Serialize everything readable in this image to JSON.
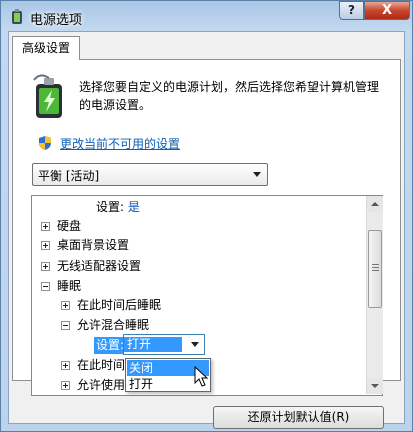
{
  "window": {
    "title": "电源选项",
    "help_label": "?",
    "close_label": "X"
  },
  "tabs": [
    {
      "label": "高级设置"
    }
  ],
  "description": {
    "line1": "选择您要自定义的电源计划，然后选择您希望计算机管理",
    "line2": "的电源设置。"
  },
  "link": {
    "label": "更改当前不可用的设置"
  },
  "plan_dropdown": {
    "selected": "平衡 [活动]"
  },
  "tree": {
    "top_setting": {
      "label": "设置:",
      "value": "是"
    },
    "items": [
      {
        "label": "硬盘",
        "expander": "+"
      },
      {
        "label": "桌面背景设置",
        "expander": "+"
      },
      {
        "label": "无线适配器设置",
        "expander": "+"
      },
      {
        "label": "睡眠",
        "expander": "-"
      },
      {
        "label": "在此时间后睡眠",
        "expander": "+"
      },
      {
        "label": "允许混合睡眠",
        "expander": "-"
      },
      {
        "label": "在此时间",
        "expander": "+"
      },
      {
        "label": "允许使用",
        "expander": "+"
      }
    ],
    "hybrid_setting": {
      "label": "设置:",
      "value": "打开",
      "options": [
        "关闭",
        "打开"
      ],
      "highlighted_option": "关闭"
    }
  },
  "buttons": {
    "restore_defaults": "还原计划默认值(R)"
  },
  "colors": {
    "accent": "#3399ff",
    "link": "#0b5fb3",
    "value_text": "#0b4fbd"
  },
  "icons": [
    "power-plan-icon",
    "shield-icon",
    "mouse-cursor-icon",
    "help-icon",
    "close-icon"
  ]
}
